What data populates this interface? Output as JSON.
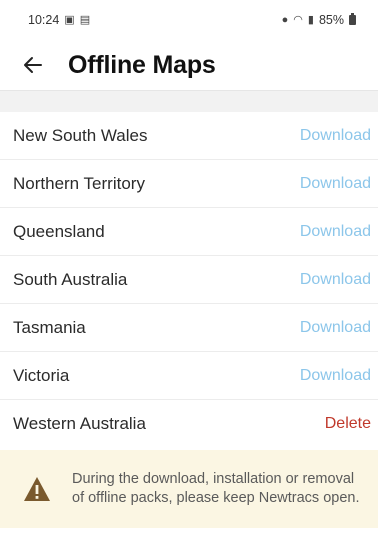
{
  "status_bar": {
    "time": "10:24",
    "battery": "85%",
    "icons": [
      "photo-icon",
      "message-icon",
      "location-icon",
      "wifi-icon",
      "signal-icon",
      "battery-icon"
    ]
  },
  "header": {
    "title": "Offline Maps",
    "back_icon": "arrow-left-icon"
  },
  "regions": [
    {
      "name": "New South Wales",
      "action": "Download"
    },
    {
      "name": "Northern Territory",
      "action": "Download"
    },
    {
      "name": "Queensland",
      "action": "Download"
    },
    {
      "name": "South Australia",
      "action": "Download"
    },
    {
      "name": "Tasmania",
      "action": "Download"
    },
    {
      "name": "Victoria",
      "action": "Download"
    },
    {
      "name": "Western Australia",
      "action": "Delete"
    }
  ],
  "notice": {
    "icon": "warning-icon",
    "text": "During the download, installation or removal of offline packs, please keep Newtracs open."
  },
  "colors": {
    "download": "#8cc6ea",
    "delete": "#c0392b",
    "notice_bg": "#fbf6e3",
    "warning_icon": "#7a5a2e"
  }
}
